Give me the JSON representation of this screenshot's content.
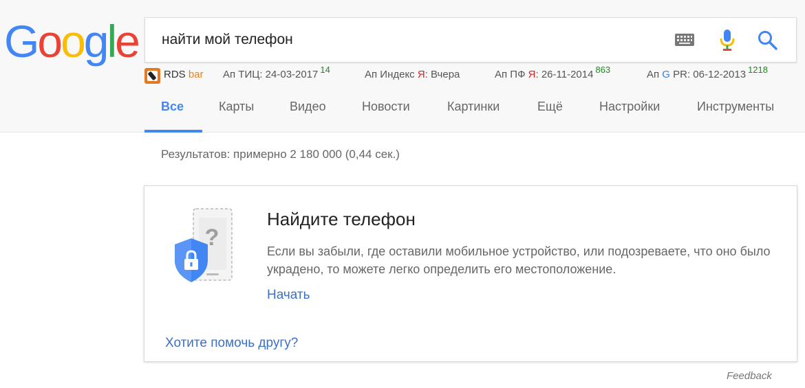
{
  "logo": {
    "letters": [
      "G",
      "o",
      "o",
      "g",
      "l",
      "e"
    ],
    "colors": [
      "#4285f4",
      "#ea4335",
      "#fbbc05",
      "#4285f4",
      "#34a853",
      "#ea4335"
    ]
  },
  "search": {
    "query": "найти мой телефон"
  },
  "rds_bar": {
    "rds": "RDS",
    "bar": "bar",
    "tic_prefix": "Ап ТИЦ: 24-03-2017",
    "tic_value": "14",
    "index_prefix": "Ап Индекс ",
    "index_ya": "Я",
    "index_suffix": ": Вчера",
    "pf_prefix": "Ап ПФ ",
    "pf_ya": "Я",
    "pf_suffix": ": 26-11-2014",
    "pf_value": "863",
    "pr_prefix": "Ап ",
    "pr_g": "G",
    "pr_suffix": " PR: 06-12-2013",
    "pr_value": "1218"
  },
  "tabs": [
    {
      "label": "Все"
    },
    {
      "label": "Карты"
    },
    {
      "label": "Видео"
    },
    {
      "label": "Новости"
    },
    {
      "label": "Картинки"
    },
    {
      "label": "Ещё"
    },
    {
      "label": "Настройки"
    },
    {
      "label": "Инструменты"
    }
  ],
  "results_stats": "Результатов: примерно 2 180 000 (0,44 сек.)",
  "card": {
    "title": "Найдите телефон",
    "description": "Если вы забыли, где оставили мобильное устройство, или подозреваете, что оно было украдено, то можете легко определить его местоположение.",
    "start_link": "Начать",
    "help_link": "Хотите помочь другу?"
  },
  "feedback": "Feedback",
  "colors": {
    "accent": "#4285f4",
    "link": "#3b6fc8",
    "rds_green": "#1a8a1a",
    "yandex_red": "#dd2222"
  }
}
